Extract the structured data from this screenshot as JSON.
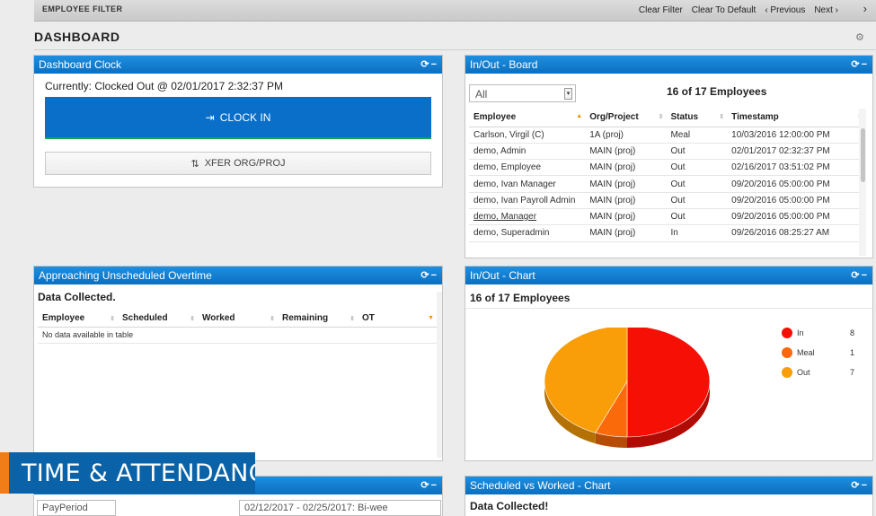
{
  "filter_bar": {
    "title": "EMPLOYEE FILTER",
    "clear_filter": "Clear Filter",
    "clear_to_default": "Clear To Default",
    "previous": "‹ Previous",
    "next": "Next ›",
    "expand": "›"
  },
  "dashboard": {
    "title": "DASHBOARD",
    "gear_icon": "⚙"
  },
  "clock": {
    "title": "Dashboard Clock",
    "controls": "⟳−",
    "status": "Currently: Clocked Out @ 02/01/2017 2:32:37 PM",
    "clock_in_label": "CLOCK IN",
    "clock_in_icon": "⇥",
    "xfer_label": "XFER ORG/PROJ",
    "xfer_icon": "⇅"
  },
  "board": {
    "title": "In/Out - Board",
    "controls": "⟳−",
    "filter_value": "All",
    "count": "16 of 17 Employees",
    "columns": [
      "Employee",
      "Org/Project",
      "Status",
      "Timestamp"
    ],
    "rows": [
      [
        "Carlson, Virgil (C)",
        "1A (proj)",
        "Meal",
        "10/03/2016 12:00:00 PM"
      ],
      [
        "demo, Admin",
        "MAIN (proj)",
        "Out",
        "02/01/2017 02:32:37 PM"
      ],
      [
        "demo, Employee",
        "MAIN (proj)",
        "Out",
        "02/16/2017 03:51:02 PM"
      ],
      [
        "demo, Ivan Manager",
        "MAIN (proj)",
        "Out",
        "09/20/2016 05:00:00 PM"
      ],
      [
        "demo, Ivan Payroll Admin",
        "MAIN (proj)",
        "Out",
        "09/20/2016 05:00:00 PM"
      ],
      [
        "demo, Manager",
        "MAIN (proj)",
        "Out",
        "09/20/2016 05:00:00 PM"
      ],
      [
        "demo, Superadmin",
        "MAIN (proj)",
        "In",
        "09/26/2016 08:25:27 AM"
      ]
    ]
  },
  "overtime": {
    "title": "Approaching Unscheduled Overtime",
    "controls": "⟳−",
    "collected": "Data Collected.",
    "columns": [
      "Employee",
      "Scheduled",
      "Worked",
      "Remaining",
      "OT"
    ],
    "empty": "No data available in table"
  },
  "chart_panel": {
    "title": "In/Out - Chart",
    "controls": "⟳−",
    "count": "16 of 17 Employees"
  },
  "chart_data": {
    "type": "pie",
    "categories": [
      "In",
      "Meal",
      "Out"
    ],
    "values": [
      8,
      1,
      7
    ],
    "colors": [
      "#f50f05",
      "#fb6a0a",
      "#f99d08"
    ]
  },
  "payperiod_panel": {
    "controls": "⟳−",
    "select_value": "PayPeriod",
    "range_value": "02/12/2017 - 02/25/2017: Bi-wee"
  },
  "svw": {
    "title": "Scheduled vs Worked - Chart",
    "controls": "⟳−",
    "collected": "Data Collected!"
  },
  "banner": {
    "text": "TIME & ATTENDANCE"
  }
}
